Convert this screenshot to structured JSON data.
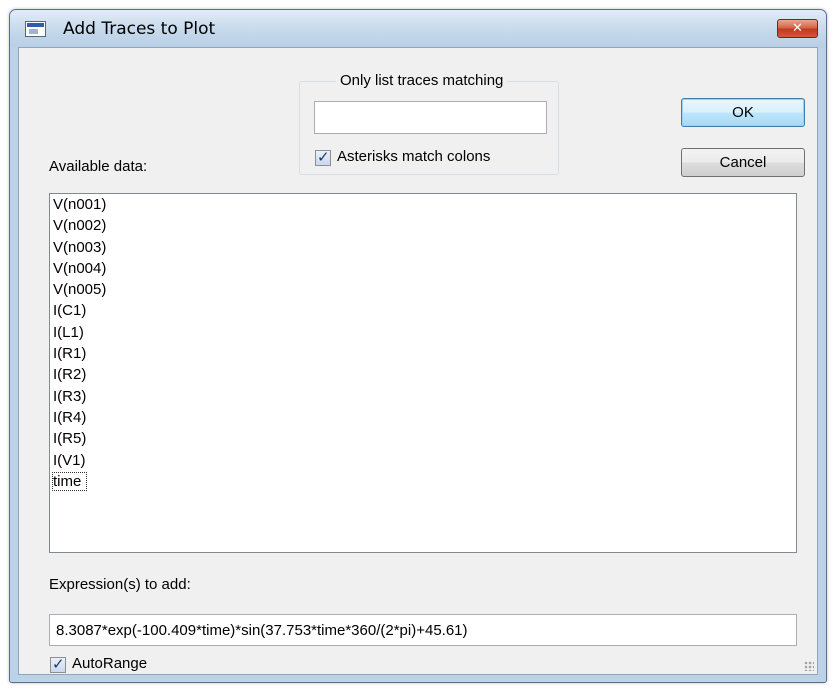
{
  "window": {
    "title": "Add Traces to Plot",
    "close_glyph": "✕"
  },
  "filter": {
    "group_label": "Only list traces matching",
    "value": "",
    "asterisks_label": "Asterisks match colons",
    "asterisks_checked": true
  },
  "buttons": {
    "ok": "OK",
    "cancel": "Cancel"
  },
  "available": {
    "label": "Available data:",
    "items": [
      "V(n001)",
      "V(n002)",
      "V(n003)",
      "V(n004)",
      "V(n005)",
      "I(C1)",
      "I(L1)",
      "I(R1)",
      "I(R2)",
      "I(R3)",
      "I(R4)",
      "I(R5)",
      "I(V1)",
      "time"
    ],
    "focused_item": "time"
  },
  "expression": {
    "label": "Expression(s) to add:",
    "value": "8.3087*exp(-100.409*time)*sin(37.753*time*360/(2*pi)+45.61)"
  },
  "autorange": {
    "label": "AutoRange",
    "checked": true
  },
  "colors": {
    "title_bar": "#c6d9ec",
    "close_button": "#c0391f",
    "dialog_background": "#f0f0f0",
    "default_button_border": "#3c7fb1"
  }
}
